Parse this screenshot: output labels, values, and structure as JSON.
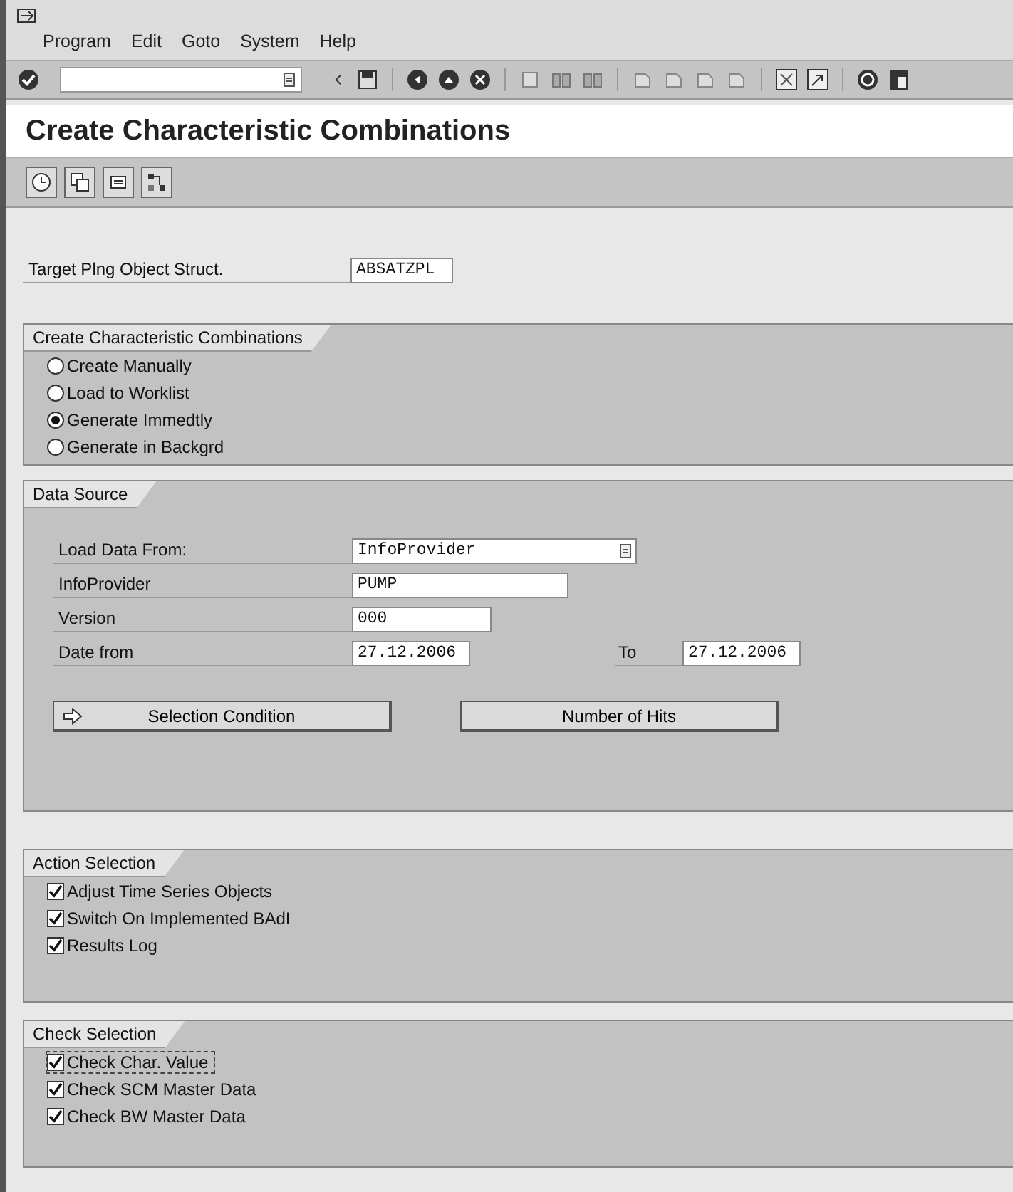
{
  "menu": [
    "Program",
    "Edit",
    "Goto",
    "System",
    "Help"
  ],
  "title": "Create Characteristic Combinations",
  "target": {
    "label": "Target Plng Object Struct.",
    "value": "ABSATZPL"
  },
  "combinations": {
    "title": "Create Characteristic Combinations",
    "options": [
      {
        "label": "Create Manually",
        "selected": false
      },
      {
        "label": "Load to Worklist",
        "selected": false
      },
      {
        "label": "Generate Immedtly",
        "selected": true
      },
      {
        "label": "Generate in Backgrd",
        "selected": false
      }
    ]
  },
  "data_source": {
    "title": "Data Source",
    "load_from": {
      "label": "Load Data From:",
      "value": "InfoProvider"
    },
    "infoprovider": {
      "label": "InfoProvider",
      "value": "PUMP"
    },
    "version": {
      "label": "Version",
      "value": "000"
    },
    "date_from": {
      "label": "Date from",
      "value": "27.12.2006"
    },
    "date_to": {
      "label": "To",
      "value": "27.12.2006"
    },
    "buttons": [
      "Selection Condition",
      "Number of Hits"
    ]
  },
  "action_selection": {
    "title": "Action Selection",
    "items": [
      {
        "label": "Adjust Time Series Objects",
        "checked": true,
        "focused": false
      },
      {
        "label": "Switch On Implemented BAdI",
        "checked": true,
        "focused": false
      },
      {
        "label": "Results Log",
        "checked": true,
        "focused": false
      }
    ]
  },
  "check_selection": {
    "title": "Check Selection",
    "items": [
      {
        "label": "Check Char. Value",
        "checked": true,
        "focused": true
      },
      {
        "label": "Check SCM Master Data",
        "checked": true,
        "focused": false
      },
      {
        "label": "Check BW Master Data",
        "checked": true,
        "focused": false
      }
    ]
  }
}
